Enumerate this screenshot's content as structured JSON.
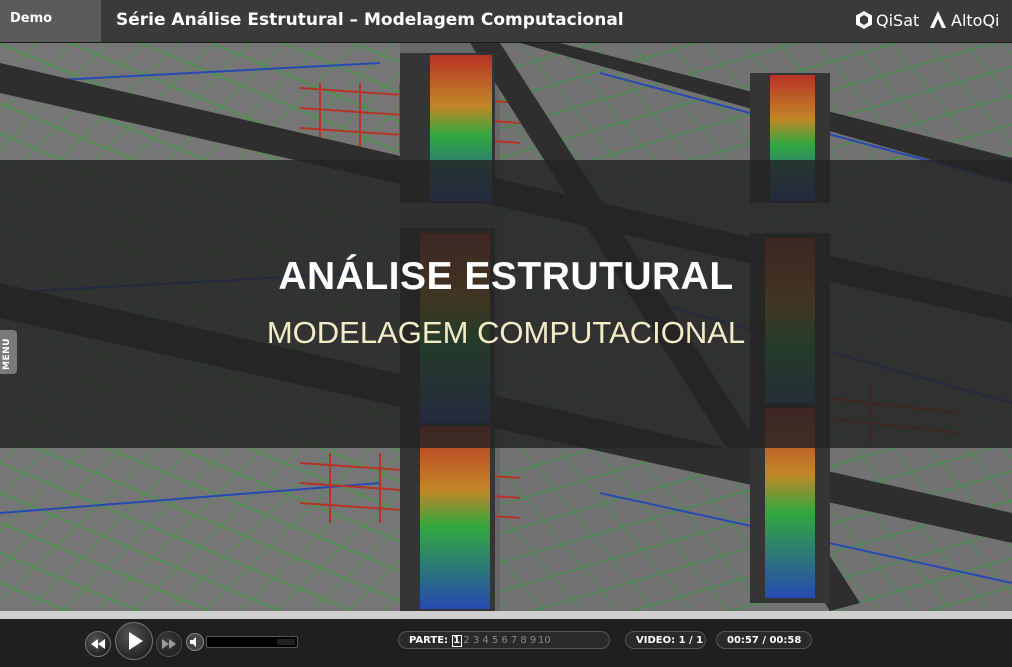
{
  "header": {
    "demo_label": "Demo",
    "title": "Série Análise Estrutural – Modelagem Computacional",
    "brand_qisat": "QiSat",
    "brand_altoqi": "AltoQi"
  },
  "slide": {
    "headline": "ANÁLISE ESTRUTURAL",
    "subtitle": "MODELAGEM COMPUTACIONAL"
  },
  "side_menu": {
    "label": "MENU"
  },
  "player": {
    "progress_fraction": 1.0,
    "volume_fraction": 0.2,
    "parts_label": "PARTE:",
    "parts": [
      "1",
      "2",
      "3",
      "4",
      "5",
      "6",
      "7",
      "8",
      "9",
      "10"
    ],
    "active_part": "1",
    "video_label": "VIDEO:",
    "video_value": "1 / 1",
    "time": "00:57 / 00:58"
  },
  "colors": {
    "header_bg": "#3a3a3a",
    "demo_tab_bg": "#5b5b5b",
    "subtitle_color": "#f2ecc8",
    "accent_red": "#e0301e",
    "accent_green": "#2ecc40",
    "accent_blue": "#1f4fd8"
  },
  "icons": {
    "rewind": "rewind-icon",
    "play": "play-icon",
    "fast_forward": "fast-forward-icon",
    "volume": "volume-icon"
  }
}
